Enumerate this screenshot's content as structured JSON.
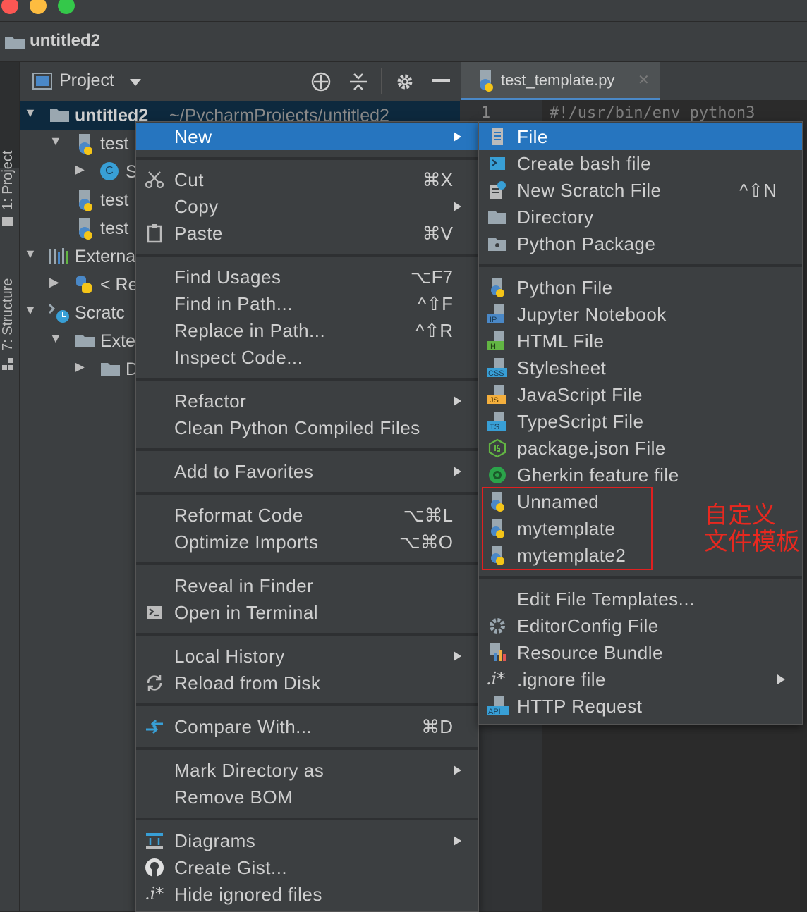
{
  "window": {
    "project_name": "untitled2",
    "traffic_lights": [
      "#fc5753",
      "#fdbc40",
      "#34c84a"
    ]
  },
  "tool_windows": {
    "project_tab": "1: Project",
    "structure_tab": "7: Structure"
  },
  "project_panel": {
    "header": "Project",
    "tree": [
      {
        "label": "untitled2",
        "path": "~/PycharmProjects/untitled2"
      },
      {
        "label": "test"
      },
      {
        "label": "S"
      },
      {
        "label": "test"
      },
      {
        "label": "test"
      },
      {
        "label": "Externa"
      },
      {
        "label": "< Re"
      },
      {
        "label": "Scratc"
      },
      {
        "label": "Exte"
      },
      {
        "label": "D"
      }
    ]
  },
  "editor": {
    "tab": "test_template.py",
    "line_number": "1",
    "first_line": "#!/usr/bin/env python3",
    "close_glyph": "✕"
  },
  "context_menu": {
    "items": [
      {
        "label": "New",
        "shortcut": "",
        "submenu": true
      },
      {
        "label": "Cut",
        "shortcut": "⌘X"
      },
      {
        "label": "Copy",
        "shortcut": "",
        "submenu": true
      },
      {
        "label": "Paste",
        "shortcut": "⌘V"
      },
      {
        "label": "Find Usages",
        "shortcut": "⌥F7"
      },
      {
        "label": "Find in Path...",
        "shortcut": "^⇧F"
      },
      {
        "label": "Replace in Path...",
        "shortcut": "^⇧R"
      },
      {
        "label": "Inspect Code...",
        "shortcut": ""
      },
      {
        "label": "Refactor",
        "shortcut": "",
        "submenu": true
      },
      {
        "label": "Clean Python Compiled Files",
        "shortcut": ""
      },
      {
        "label": "Add to Favorites",
        "shortcut": "",
        "submenu": true
      },
      {
        "label": "Reformat Code",
        "shortcut": "⌥⌘L"
      },
      {
        "label": "Optimize Imports",
        "shortcut": "⌥⌘O"
      },
      {
        "label": "Reveal in Finder",
        "shortcut": ""
      },
      {
        "label": "Open in Terminal",
        "shortcut": ""
      },
      {
        "label": "Local History",
        "shortcut": "",
        "submenu": true
      },
      {
        "label": "Reload from Disk",
        "shortcut": ""
      },
      {
        "label": "Compare With...",
        "shortcut": "⌘D"
      },
      {
        "label": "Mark Directory as",
        "shortcut": "",
        "submenu": true
      },
      {
        "label": "Remove BOM",
        "shortcut": ""
      },
      {
        "label": "Diagrams",
        "shortcut": "",
        "submenu": true
      },
      {
        "label": "Create Gist...",
        "shortcut": ""
      },
      {
        "label": "Hide ignored files",
        "shortcut": ""
      }
    ]
  },
  "new_submenu": {
    "items": [
      {
        "label": "File",
        "shortcut": ""
      },
      {
        "label": "Create bash file",
        "shortcut": ""
      },
      {
        "label": "New Scratch File",
        "shortcut": "^⇧N"
      },
      {
        "label": "Directory",
        "shortcut": ""
      },
      {
        "label": "Python Package",
        "shortcut": ""
      },
      {
        "label": "Python File",
        "shortcut": ""
      },
      {
        "label": "Jupyter Notebook",
        "shortcut": ""
      },
      {
        "label": "HTML File",
        "shortcut": ""
      },
      {
        "label": "Stylesheet",
        "shortcut": ""
      },
      {
        "label": "JavaScript File",
        "shortcut": ""
      },
      {
        "label": "TypeScript File",
        "shortcut": ""
      },
      {
        "label": "package.json File",
        "shortcut": ""
      },
      {
        "label": "Gherkin feature file",
        "shortcut": ""
      },
      {
        "label": "Unnamed",
        "shortcut": ""
      },
      {
        "label": "mytemplate",
        "shortcut": ""
      },
      {
        "label": "mytemplate2",
        "shortcut": ""
      },
      {
        "label": "Edit File Templates...",
        "shortcut": ""
      },
      {
        "label": "EditorConfig File",
        "shortcut": ""
      },
      {
        "label": "Resource Bundle",
        "shortcut": ""
      },
      {
        "label": ".ignore file",
        "shortcut": "",
        "submenu": true
      },
      {
        "label": "HTTP Request",
        "shortcut": ""
      }
    ]
  },
  "icon_badges": {
    "ip": "IP",
    "h": "H",
    "css": "CSS",
    "js": "JS",
    "ts": "TS",
    "api": "API",
    "ignore": ".i*",
    "class": "C"
  },
  "annotation": {
    "line1": "自定义",
    "line2": "文件模板",
    "color": "#e8281f"
  }
}
